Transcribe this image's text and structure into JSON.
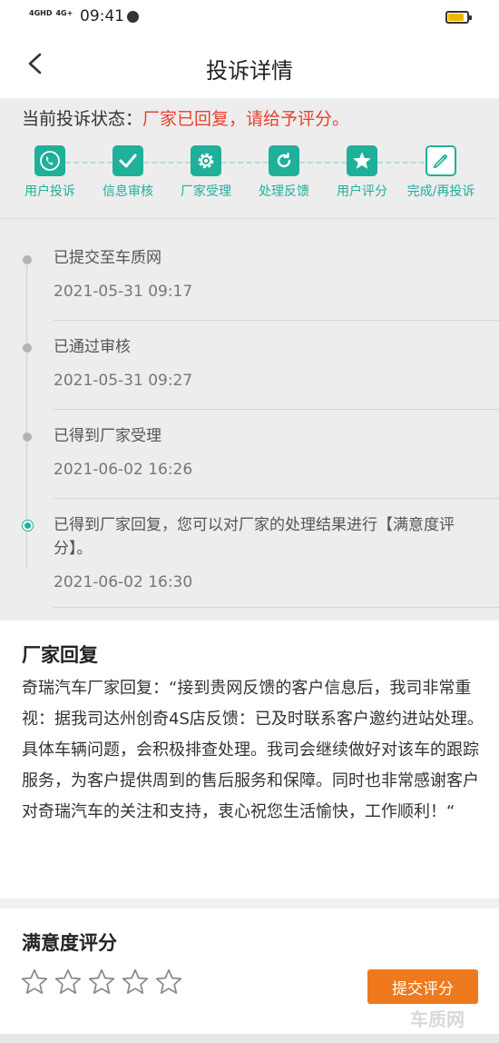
{
  "status_bar": {
    "network1": "4GHD",
    "network2": "4G+",
    "time": "09:41"
  },
  "nav": {
    "title": "投诉详情"
  },
  "status": {
    "label": "当前投诉状态：",
    "value": "厂家已回复，请给予评分。"
  },
  "steps": [
    {
      "label": "用户投诉",
      "icon": "phone-icon"
    },
    {
      "label": "信息审核",
      "icon": "check-icon"
    },
    {
      "label": "厂家受理",
      "icon": "gear-icon"
    },
    {
      "label": "处理反馈",
      "icon": "refresh-icon"
    },
    {
      "label": "用户评分",
      "icon": "star-icon"
    },
    {
      "label": "完成/再投诉",
      "icon": "pen-icon"
    }
  ],
  "timeline": [
    {
      "text": "已提交至车质网",
      "time": "2021-05-31 09:17"
    },
    {
      "text": "已通过审核",
      "time": "2021-05-31 09:27"
    },
    {
      "text": "已得到厂家受理",
      "time": "2021-06-02 16:26"
    },
    {
      "text": "已得到厂家回复，您可以对厂家的处理结果进行【满意度评分】。",
      "time": "2021-06-02 16:30"
    }
  ],
  "reply": {
    "heading": "厂家回复",
    "body": "奇瑞汽车厂家回复：“接到贵网反馈的客户信息后，我司非常重视：据我司达州创奇4S店反馈：已及时联系客户邀约进站处理。具体车辆问题，会积极排查处理。我司会继续做好对该车的跟踪服务，为客户提供周到的售后服务和保障。同时也非常感谢客户对奇瑞汽车的关注和支持，衷心祝您生活愉快，工作顺利！“"
  },
  "rating": {
    "heading": "满意度评分",
    "submit_label": "提交评分",
    "stars": 5
  },
  "watermark": "车质网",
  "colors": {
    "accent": "#1fb09a",
    "alert": "#e8412f",
    "button": "#ee7a1d"
  }
}
